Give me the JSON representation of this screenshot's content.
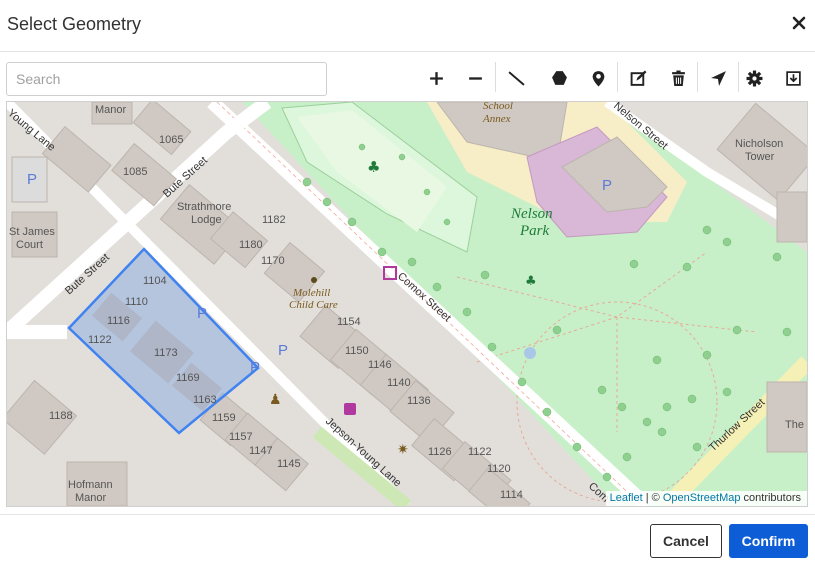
{
  "dialog": {
    "title": "Select Geometry",
    "close_icon": "close-icon"
  },
  "search": {
    "placeholder": "Search",
    "value": ""
  },
  "toolbar": {
    "tools": [
      "zoom-in",
      "zoom-out",
      "draw-line",
      "draw-polygon",
      "draw-marker",
      "edit",
      "delete",
      "locate",
      "settings",
      "download"
    ]
  },
  "map": {
    "labels": {
      "manor": "Manor",
      "young_lane": "Young Lane",
      "school": "School",
      "annex": "Annex",
      "nelson_street": "Nelson Street",
      "nicholson": "Nicholson",
      "tower": "Tower",
      "b1065": "1065",
      "b1085": "1085",
      "bute_street_1": "Bute Street",
      "p1": "P",
      "st_james": "St James",
      "court": "Court",
      "strathmore": "Strathmore",
      "lodge": "Lodge",
      "b1182": "1182",
      "b1180": "1180",
      "b1170": "1170",
      "nelson": "Nelson",
      "park": "Park",
      "bute_street_2": "Bute Street",
      "b1104": "1104",
      "b1110": "1110",
      "b1116": "1116",
      "b1122": "1122",
      "b1173": "1173",
      "b1169": "1169",
      "b1163": "1163",
      "molehill": "Molehill",
      "child_care": "Child Care",
      "b1154": "1154",
      "b1150": "1150",
      "b1146": "1146",
      "b1140": "1140",
      "b1136": "1136",
      "comox_street": "Comox Street",
      "b1188": "1188",
      "b1159": "1159",
      "b1157": "1157",
      "b1147": "1147",
      "b1145": "1145",
      "jepson_young": "Jepson-Young Lane",
      "b1126": "1126",
      "b1122b": "1122",
      "b1120": "1120",
      "b1114": "1114",
      "thurlow": "Thurlow Street",
      "hofmann": "Hofmann",
      "manor2": "Manor",
      "comox_short": "Com",
      "the_t": "The T"
    },
    "attribution": {
      "leaflet": "Leaflet",
      "sep": " | © ",
      "osm": "OpenStreetMap",
      "contrib": " contributors"
    }
  },
  "footer": {
    "cancel_label": "Cancel",
    "confirm_label": "Confirm"
  },
  "colors": {
    "accent": "#0d5ed6",
    "selection_fill": "#8faee0",
    "selection_stroke": "#3f82f0",
    "park": "#c8f0c8"
  }
}
